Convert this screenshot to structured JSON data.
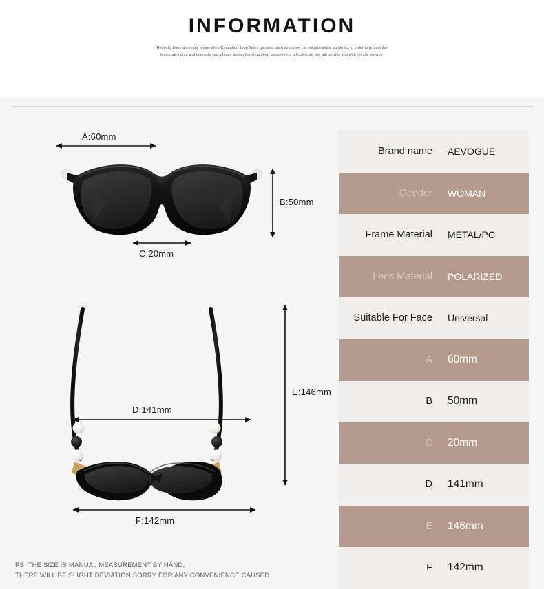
{
  "header": {
    "title": "INFORMATION",
    "subtitle": "Recently there are many online shop Chuanhuo Jeep Sales glasses, such shops we cannot guarantee authentic, in order to protect the legitimate rights and interests you, please assign the shop Jeep glasses lynx official store, we will provide you with regular service."
  },
  "diagrams": {
    "front_view": {
      "name": "sunglasses-front-view",
      "measurements": {
        "a": "A:60mm",
        "b": "B:50mm",
        "c": "C:20mm"
      }
    },
    "top_view": {
      "name": "sunglasses-top-view",
      "measurements": {
        "d": "D:141mm",
        "e": "E:146mm",
        "f": "F:142mm"
      }
    }
  },
  "footnote": {
    "line1": "PS: THE SIZE IS MANUAL MEASUREMENT BY HAND,",
    "line2": "THERE WILL BE SLIGHT DEVIATION,SORRY FOR ANY CONVENIENCE CAUSED"
  },
  "spec_table": {
    "rows": [
      {
        "label": "Brand name",
        "value": "AEVOGUE",
        "style": "light"
      },
      {
        "label": "Gender",
        "value": "WOMAN",
        "style": "dark"
      },
      {
        "label": "Frame Material",
        "value": "METAL/PC",
        "style": "light"
      },
      {
        "label": "Lens Material",
        "value": "POLARIZED",
        "style": "dark"
      },
      {
        "label": "Suitable For Face",
        "value": "Universal",
        "style": "light"
      },
      {
        "label": "A",
        "value": "60mm",
        "style": "dark"
      },
      {
        "label": "B",
        "value": "50mm",
        "style": "light"
      },
      {
        "label": "C",
        "value": "20mm",
        "style": "dark"
      },
      {
        "label": "D",
        "value": "141mm",
        "style": "light"
      },
      {
        "label": "E",
        "value": "146mm",
        "style": "dark"
      },
      {
        "label": "F",
        "value": "142mm",
        "style": "light"
      }
    ]
  },
  "colors": {
    "accent": "#b59b8d",
    "light_row": "#efeeec",
    "page_bg": "#f5f5f5",
    "header_bg": "#ffffff",
    "text": "#1a1a1a"
  }
}
